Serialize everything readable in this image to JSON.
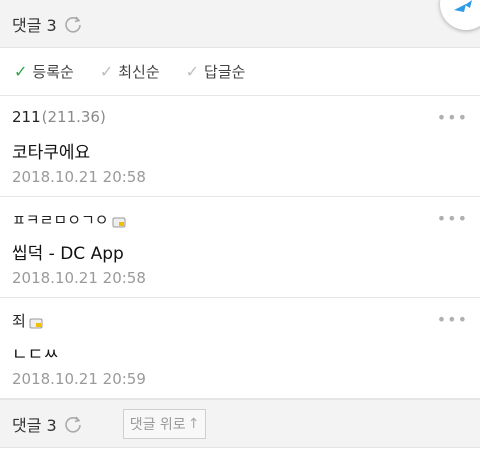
{
  "header": {
    "title": "댓글 3"
  },
  "sort": [
    {
      "label": "등록순",
      "active": true
    },
    {
      "label": "최신순",
      "active": false
    },
    {
      "label": "답글순",
      "active": false
    }
  ],
  "comments": [
    {
      "author": "211",
      "ip": "(211.36)",
      "body": "코타쿠에요",
      "date": "2018.10.21 20:58",
      "badge": false
    },
    {
      "author": "ㅍㅋㄹㅁㅇㄱㅇ",
      "ip": "",
      "body": "씹덕 - DC App",
      "date": "2018.10.21 20:58",
      "badge": true
    },
    {
      "author": "죄",
      "ip": "",
      "body": "ㄴㄷㅆ",
      "date": "2018.10.21 20:59",
      "badge": true
    }
  ],
  "more_label": "•••",
  "footer": {
    "title": "댓글 3",
    "up_label": "댓글 위로",
    "up_arrow": "↑"
  },
  "colors": {
    "check_active": "#2ea24a",
    "bar_bg": "#f3f3f3"
  }
}
